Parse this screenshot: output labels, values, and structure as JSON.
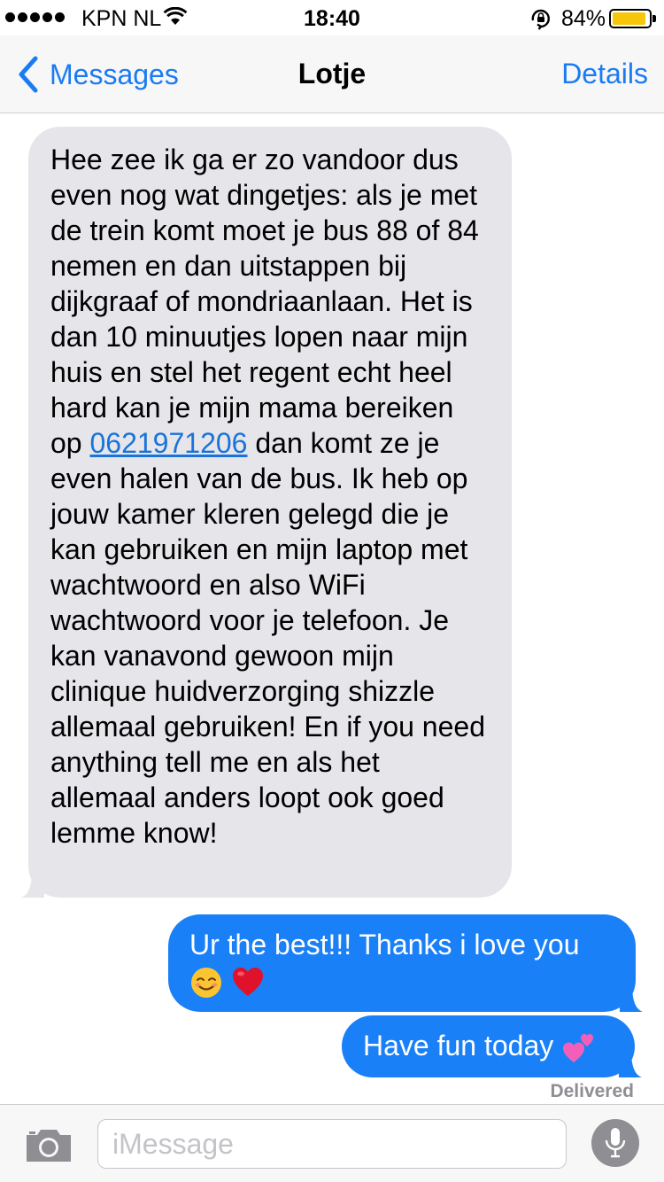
{
  "status_bar": {
    "signal_dots": 5,
    "carrier": "KPN NL",
    "wifi_icon": "wifi-icon",
    "time": "18:40",
    "rotation_lock_icon": "rotation-lock-icon",
    "battery_text": "84%",
    "battery_level": 0.84,
    "battery_color": "#f5c60a"
  },
  "nav": {
    "back_label": "Messages",
    "title": "Lotje",
    "details_label": "Details"
  },
  "messages": {
    "incoming": {
      "text_before_link": "Hee zee ik ga er zo vandoor dus even nog wat dingetjes: als je met de trein komt moet je bus 88 of 84 nemen en dan uitstappen bij dijkgraaf of mondriaanlaan. Het is dan 10 minuutjes lopen naar mijn huis en stel het regent echt heel hard kan je mijn mama bereiken op ",
      "phone_link": "0621971206",
      "text_after_link": " dan komt ze je even halen van de bus. Ik heb op jouw kamer kleren gelegd die je kan gebruiken en mijn laptop met wachtwoord en also WiFi wachtwoord voor je telefoon. Je kan vanavond gewoon mijn clinique huidverzorging shizzle allemaal gebruiken! En if you need anything tell me en als het allemaal anders loopt ook goed lemme know!"
    },
    "outgoing": [
      {
        "text": "Ur the best!!! Thanks i love you",
        "emojis": [
          "smiling-face-icon",
          "red-heart-icon"
        ]
      },
      {
        "text": "Have fun today",
        "emojis": [
          "two-hearts-icon"
        ]
      }
    ],
    "delivered_label": "Delivered"
  },
  "input_bar": {
    "camera_icon": "camera-icon",
    "placeholder": "iMessage",
    "value": "",
    "mic_icon": "microphone-icon"
  },
  "colors": {
    "accent": "#1a7bf2",
    "outgoing_bubble": "#1a80f8",
    "incoming_bubble": "#e5e5ea",
    "delivered_text": "#8e8e93"
  }
}
